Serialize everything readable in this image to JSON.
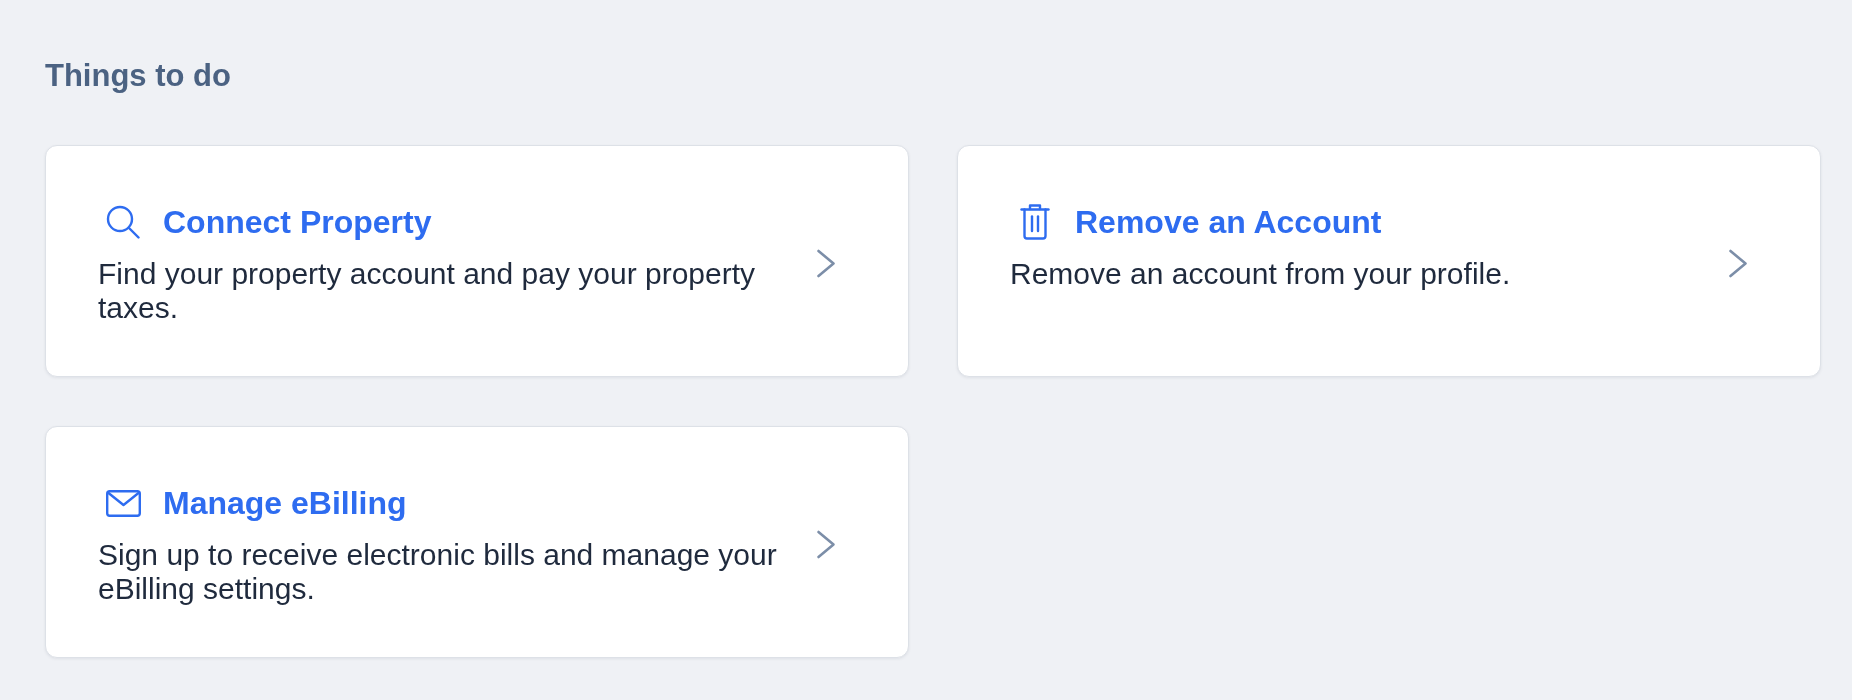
{
  "section": {
    "title": "Things to do"
  },
  "cards": [
    {
      "kind": "search",
      "title": "Connect Property",
      "description": "Find your property account and pay your property taxes."
    },
    {
      "kind": "trash",
      "title": "Remove an Account",
      "description": "Remove an account from your profile."
    },
    {
      "kind": "mail",
      "title": "Manage eBilling",
      "description": "Sign up to receive electronic bills and manage your eBilling settings."
    }
  ]
}
